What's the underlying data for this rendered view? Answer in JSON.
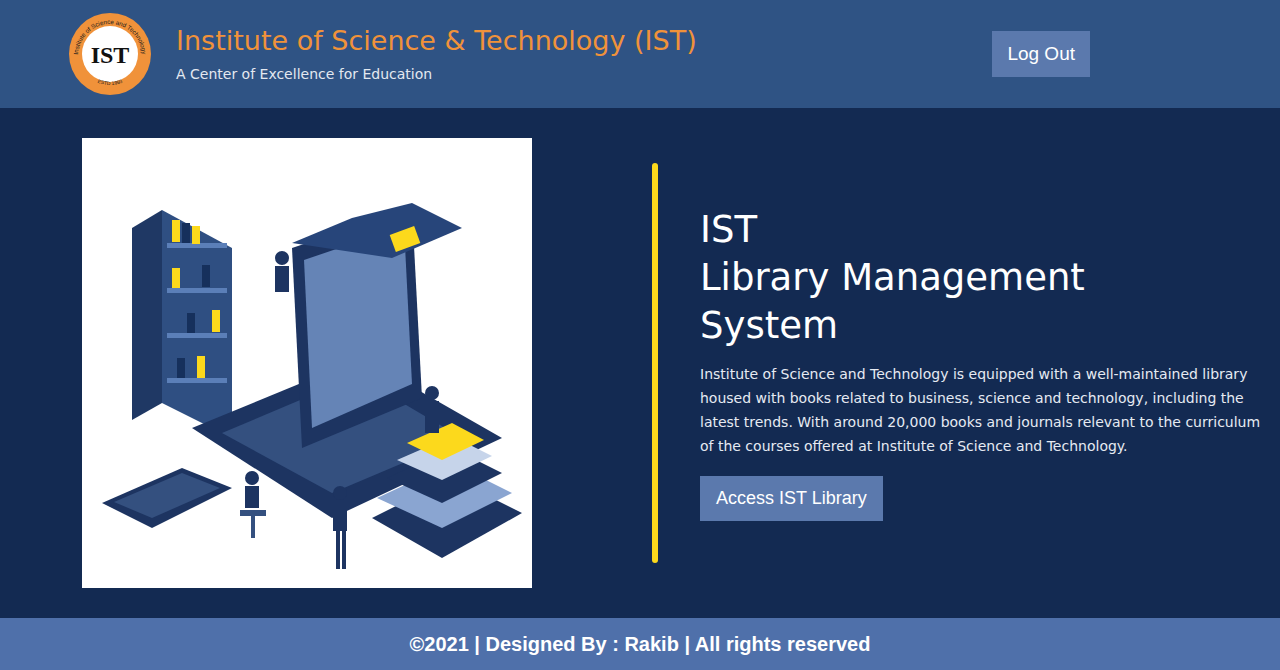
{
  "header": {
    "logo": {
      "mark": "IST",
      "caption": "Institute of Science and Technology",
      "estd": "ESTD 1993"
    },
    "title": "Institute of Science & Technology (IST)",
    "subtitle": "A Center of Excellence for Education",
    "logout_button": "Log Out"
  },
  "hero": {
    "heading_lines": [
      "IST",
      "Library Management",
      "System"
    ],
    "description": "Institute of Science and Technology is equipped with a well-maintained library housed with books related to business, science and technology, including the latest trends. With around 20,000 books and journals relevant to the curriculum of the courses offered at Institute of Science and Technology.",
    "button": "Access IST Library"
  },
  "footer": "©2021 | Designed By : Rakib | All rights reserved"
}
